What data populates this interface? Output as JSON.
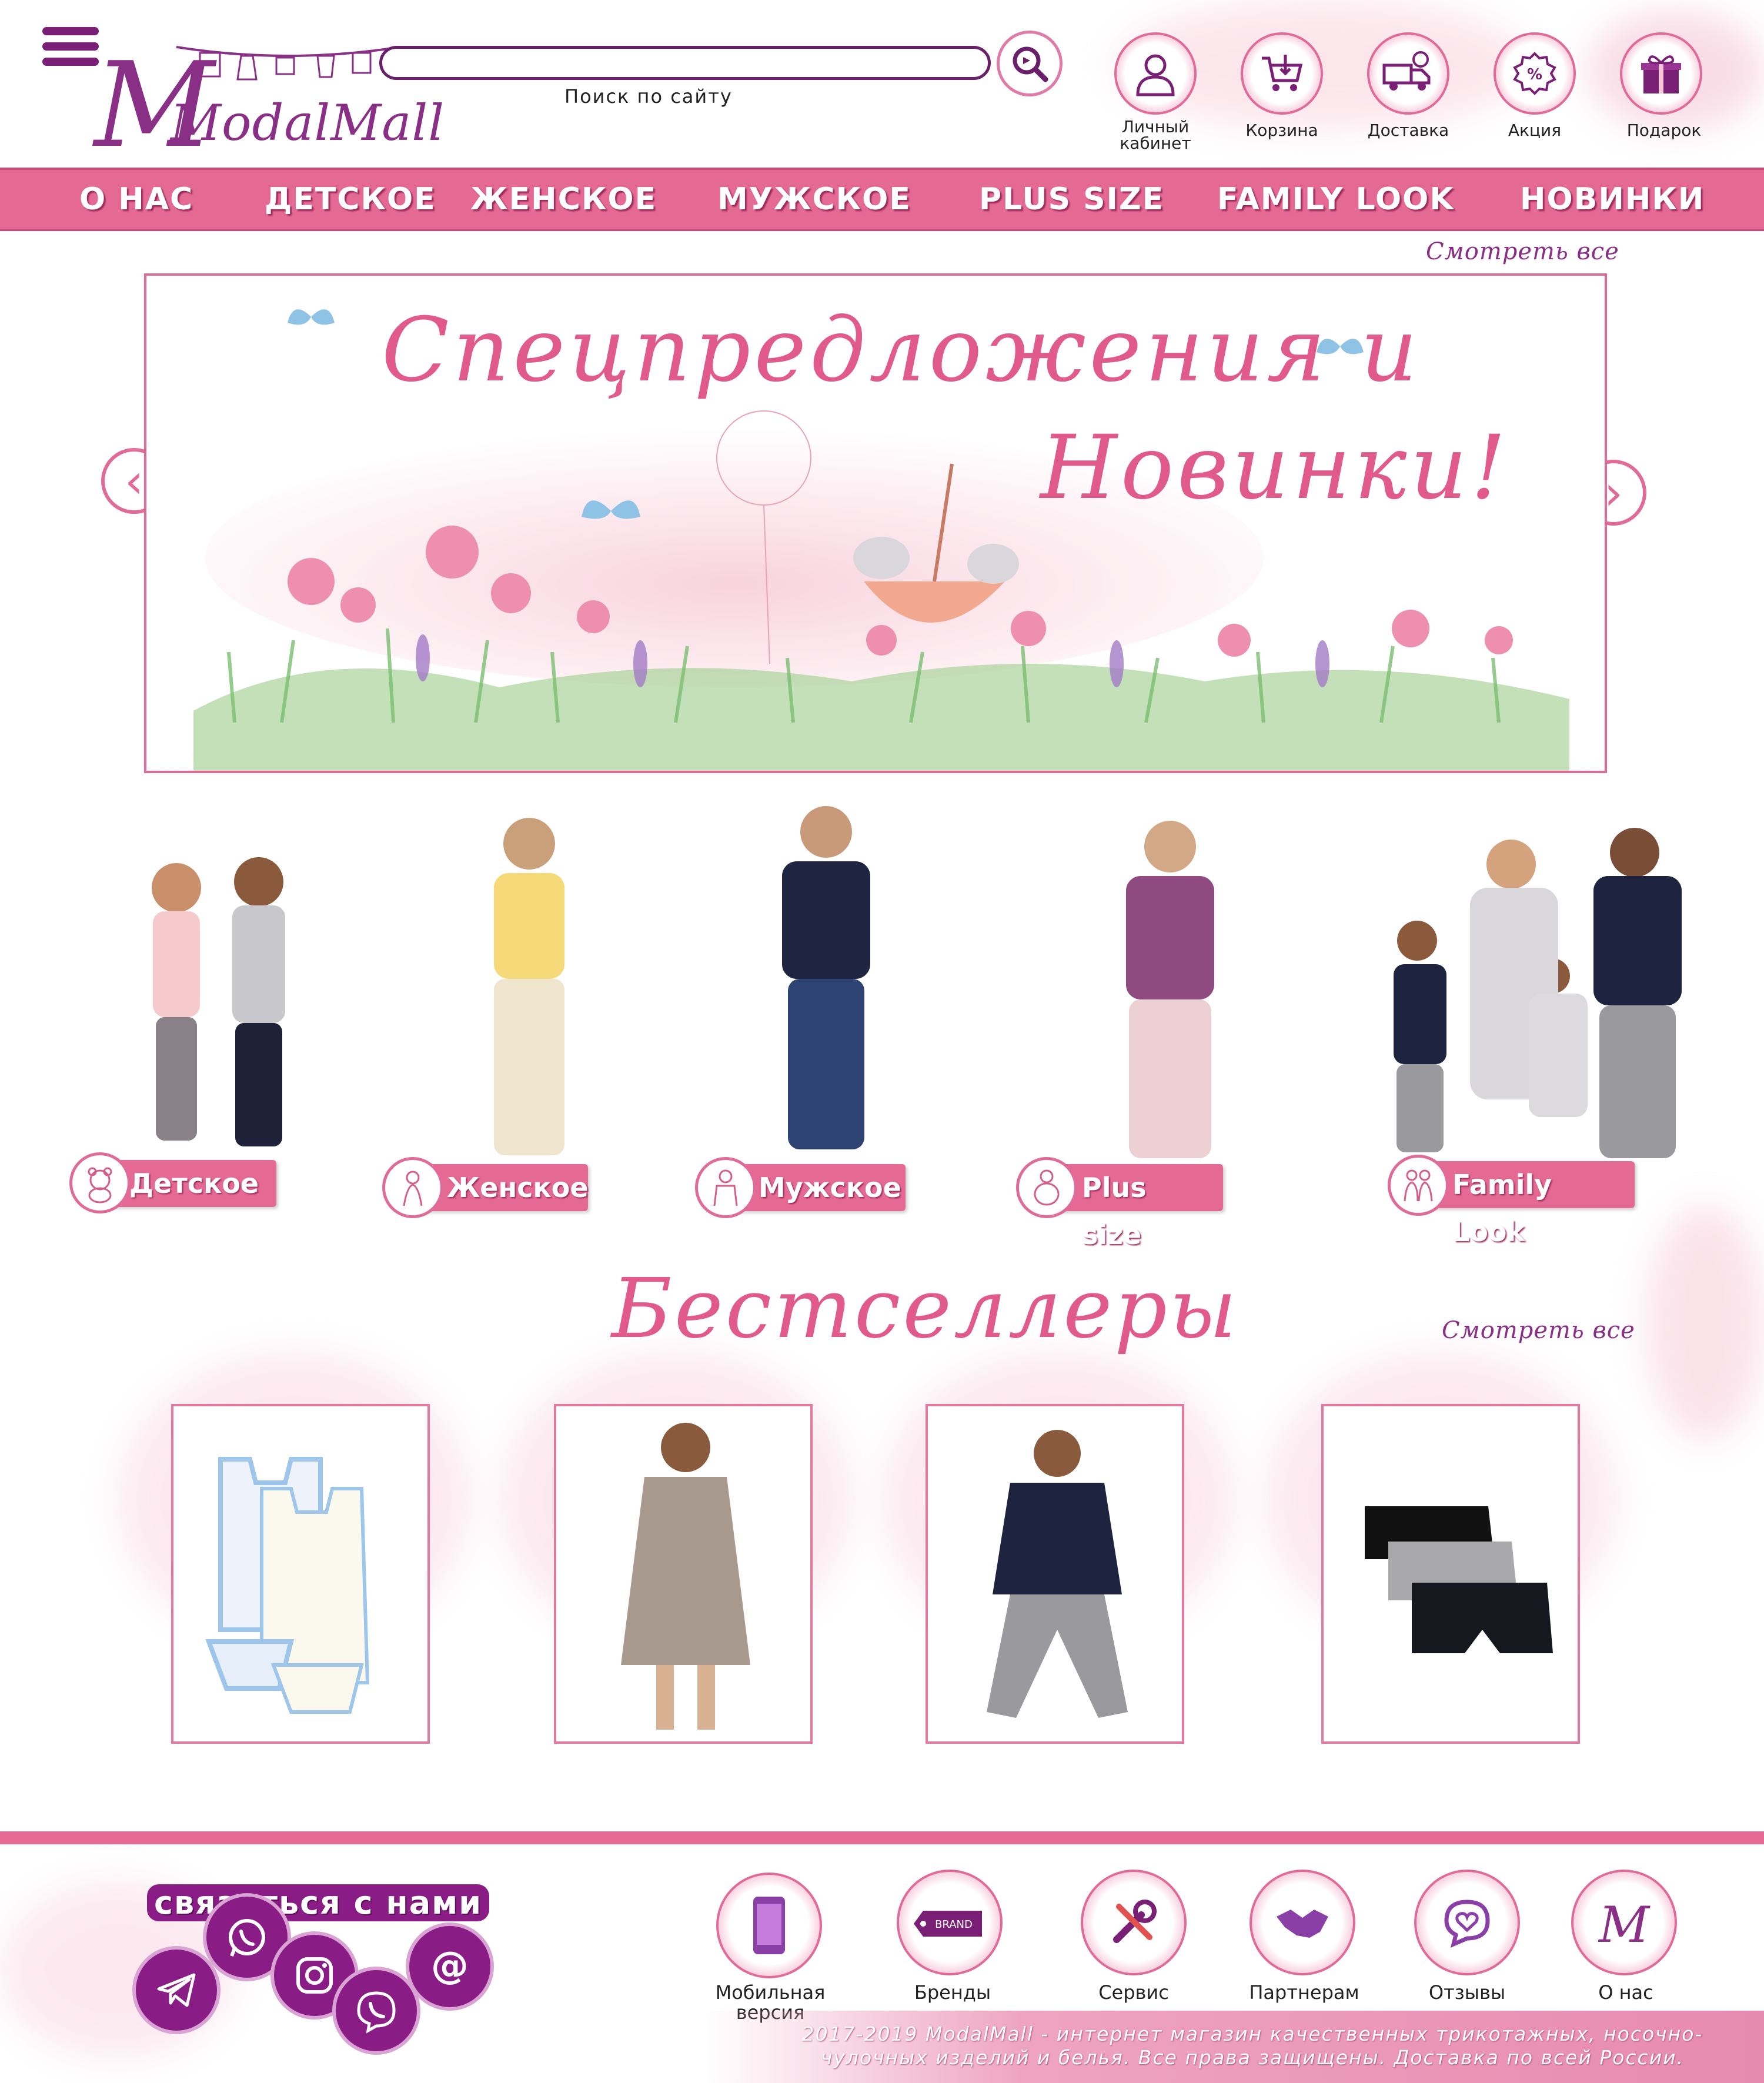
{
  "header": {
    "logo_text": "ModalMall",
    "search_caption": "Поиск по сайту",
    "icons": [
      {
        "label": "Личный кабинет",
        "icon": "user-icon"
      },
      {
        "label": "Корзина",
        "icon": "cart-icon"
      },
      {
        "label": "Доставка",
        "icon": "truck-icon"
      },
      {
        "label": "Акция",
        "icon": "discount-icon"
      },
      {
        "label": "Подарок",
        "icon": "gift-icon"
      }
    ]
  },
  "nav": {
    "items": [
      "О НАС",
      "ДЕТСКОЕ",
      "ЖЕНСКОЕ",
      "МУЖСКОЕ",
      "PLUS SIZE",
      "FAMILY LOOK",
      "НОВИНКИ"
    ]
  },
  "banner": {
    "see_all": "Смотреть все",
    "title_line1": "Спецпредложения и",
    "title_line2": "Новинки!",
    "prev": "‹",
    "next": "›"
  },
  "categories": [
    {
      "label": "Детское"
    },
    {
      "label": "Женское"
    },
    {
      "label": "Мужское"
    },
    {
      "label": "Plus size"
    },
    {
      "label": "Family Look"
    }
  ],
  "bestsellers": {
    "title": "Бестселлеры",
    "see_all": "Смотреть все"
  },
  "footer": {
    "contact_title": "связаться с нами",
    "social": [
      "telegram-icon",
      "whatsapp-icon",
      "instagram-icon",
      "viber-icon",
      "email-icon"
    ],
    "links": [
      {
        "label": "Мобильная версия",
        "icon": "phone-icon"
      },
      {
        "label": "Бренды",
        "icon": "brand-tag-icon",
        "tag": "BRAND"
      },
      {
        "label": "Сервис",
        "icon": "tools-icon"
      },
      {
        "label": "Партнерам",
        "icon": "handshake-icon"
      },
      {
        "label": "Отзывы",
        "icon": "chat-heart-icon"
      },
      {
        "label": "О нас",
        "icon": "logo-m-icon",
        "letter": "M"
      }
    ],
    "copyright": "2017-2019 ModalMall - интернет магазин качественных трикотажных, носочно-чулочных изделий и белья. Все права защищены. Доставка по всей России."
  },
  "colors": {
    "accent_pink": "#e46a93",
    "brand_purple": "#8a1d85",
    "title_pink": "#e05a8c"
  }
}
